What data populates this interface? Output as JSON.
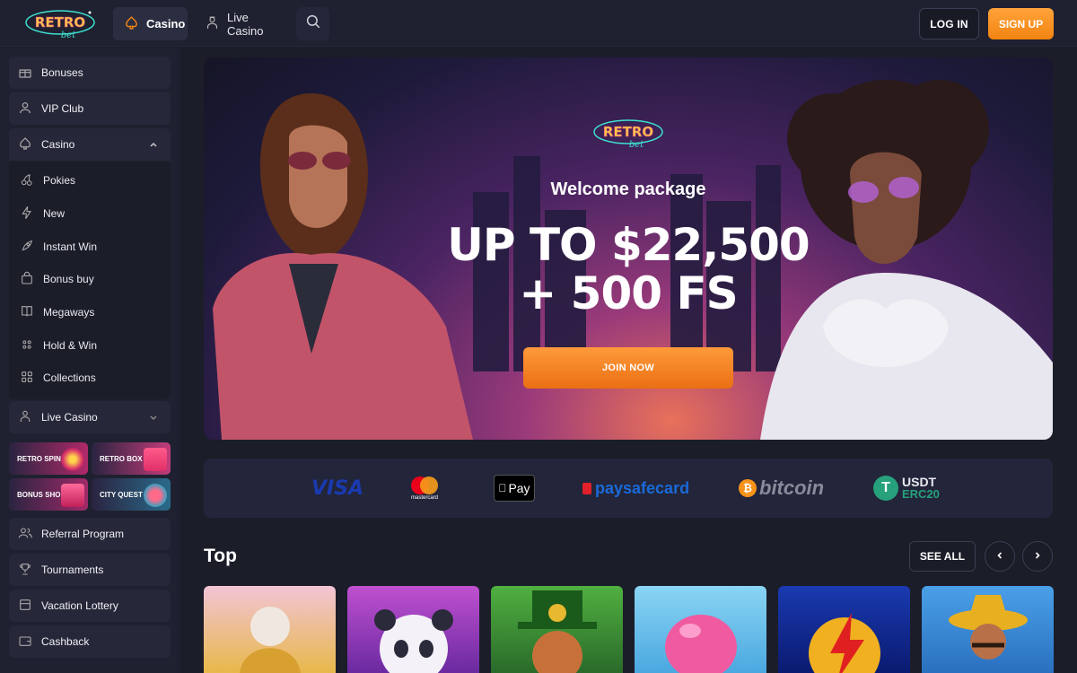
{
  "header": {
    "logo_text_top": "RETRO",
    "logo_text_bottom": "bet",
    "nav": [
      {
        "label": "Casino",
        "icon": "spade-icon",
        "active": true
      },
      {
        "label": "Live Casino",
        "icon": "dealer-icon",
        "active": false
      }
    ],
    "login_label": "LOG IN",
    "signup_label": "SIGN UP"
  },
  "sidebar": {
    "top_items": [
      {
        "label": "Bonuses",
        "icon": "gift-icon"
      },
      {
        "label": "VIP Club",
        "icon": "user-icon"
      },
      {
        "label": "Casino",
        "icon": "spade-icon"
      }
    ],
    "casino_sub": [
      {
        "label": "Pokies",
        "icon": "cherries-icon"
      },
      {
        "label": "New",
        "icon": "bolt-icon"
      },
      {
        "label": "Instant Win",
        "icon": "rocket-icon"
      },
      {
        "label": "Bonus buy",
        "icon": "bag-icon"
      },
      {
        "label": "Megaways",
        "icon": "book-icon"
      },
      {
        "label": "Hold & Win",
        "icon": "dice-icon"
      },
      {
        "label": "Collections",
        "icon": "grid-icon"
      }
    ],
    "live_casino_label": "Live Casino",
    "promos": [
      {
        "label": "RETRO SPIN",
        "color": "#c2306b"
      },
      {
        "label": "RETRO BOX",
        "color": "#c23c7a"
      },
      {
        "label": "BONUS SHOP",
        "color": "#a02a6a"
      },
      {
        "label": "CITY QUEST",
        "color": "#2a6a8a"
      }
    ],
    "bottom_items": [
      {
        "label": "Referral Program",
        "icon": "users-icon"
      },
      {
        "label": "Tournaments",
        "icon": "trophy-icon"
      },
      {
        "label": "Vacation Lottery",
        "icon": "ticket-icon"
      },
      {
        "label": "Cashback",
        "icon": "wallet-icon"
      }
    ]
  },
  "banner": {
    "logo_text_top": "RETRO",
    "logo_text_bottom": "bet",
    "welcome": "Welcome package",
    "headline_line1": "UP TO $22,500",
    "headline_line2": "+ 500 FS",
    "cta": "JOIN NOW"
  },
  "payments": {
    "visa": "VISA",
    "mastercard": "mastercard",
    "applepay": "Pay",
    "paysafecard": "paysafecard",
    "bitcoin": "bitcoin",
    "usdt_top": "USDT",
    "usdt_bottom": "ERC20"
  },
  "top_section": {
    "title": "Top",
    "see_all": "SEE ALL",
    "games": [
      {
        "name": "zeus-game",
        "bg": "#e8b84a"
      },
      {
        "name": "panda-game",
        "bg": "#8a3fb0"
      },
      {
        "name": "leprechaun-game",
        "bg": "#2a8a3a"
      },
      {
        "name": "candy-game",
        "bg": "#5ab8e8"
      },
      {
        "name": "lightning-game",
        "bg": "#1a4ab8"
      },
      {
        "name": "mariachi-game",
        "bg": "#3a8ad8"
      }
    ]
  },
  "colors": {
    "accent_orange": "#f28411",
    "background": "#1b1d29",
    "panel": "#262839"
  }
}
